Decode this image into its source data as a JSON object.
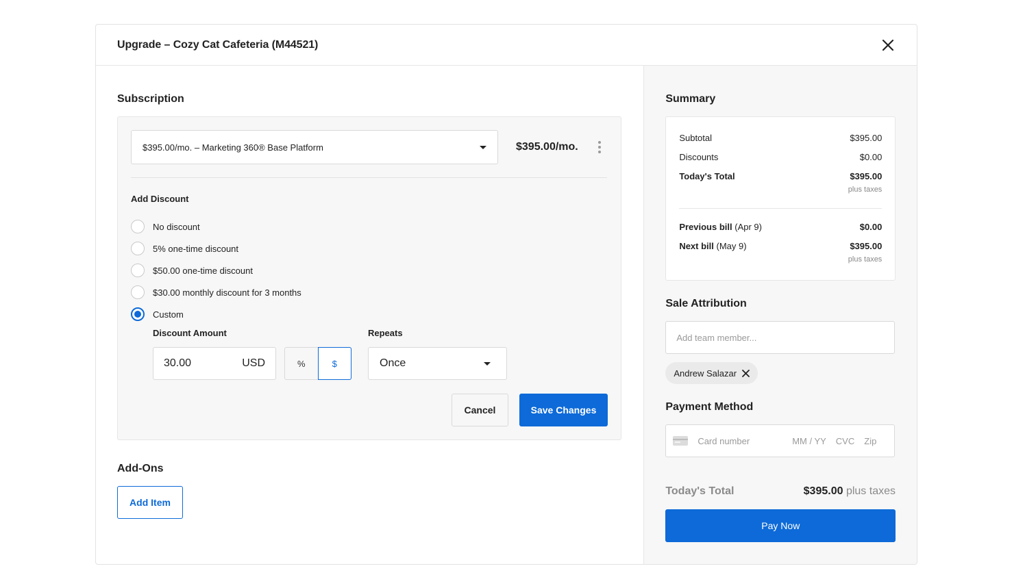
{
  "modal": {
    "title": "Upgrade – Cozy Cat Cafeteria (M44521)"
  },
  "subscription": {
    "section_title": "Subscription",
    "plan_selected": "$395.00/mo. – Marketing 360® Base Platform",
    "plan_price": "$395.00/mo.",
    "add_discount_label": "Add Discount",
    "discount_options": [
      {
        "label": "No discount",
        "checked": false
      },
      {
        "label": "5% one-time discount",
        "checked": false
      },
      {
        "label": "$50.00 one-time discount",
        "checked": false
      },
      {
        "label": "$30.00 monthly discount for 3 months",
        "checked": false
      },
      {
        "label": "Custom",
        "checked": true
      }
    ],
    "discount_amount_label": "Discount Amount",
    "discount_amount_value": "30.00",
    "discount_currency": "USD",
    "unit_percent": "%",
    "unit_dollar": "$",
    "unit_selected": "$",
    "repeats_label": "Repeats",
    "repeats_value": "Once",
    "cancel_label": "Cancel",
    "save_label": "Save Changes"
  },
  "addons": {
    "section_title": "Add-Ons",
    "add_item_label": "Add Item"
  },
  "summary": {
    "section_title": "Summary",
    "subtotal_label": "Subtotal",
    "subtotal_value": "$395.00",
    "discounts_label": "Discounts",
    "discounts_value": "$0.00",
    "todays_total_label": "Today's Total",
    "todays_total_value": "$395.00",
    "plus_taxes": "plus taxes",
    "previous_bill_label": "Previous bill",
    "previous_bill_date": "(Apr 9)",
    "previous_bill_value": "$0.00",
    "next_bill_label": "Next bill",
    "next_bill_date": "(May 9)",
    "next_bill_value": "$395.00"
  },
  "sale_attribution": {
    "section_title": "Sale Attribution",
    "placeholder": "Add team member...",
    "members": [
      "Andrew Salazar"
    ]
  },
  "payment": {
    "section_title": "Payment Method",
    "card_number_placeholder": "Card number",
    "expiry_placeholder": "MM / YY",
    "cvc_placeholder": "CVC",
    "zip_placeholder": "Zip",
    "total_label": "Today's Total",
    "total_value": "$395.00",
    "total_suffix": "plus taxes",
    "pay_label": "Pay Now"
  },
  "colors": {
    "primary": "#0d6ad8",
    "panel_bg": "#f7f7f7",
    "border": "#d9d9d9"
  }
}
